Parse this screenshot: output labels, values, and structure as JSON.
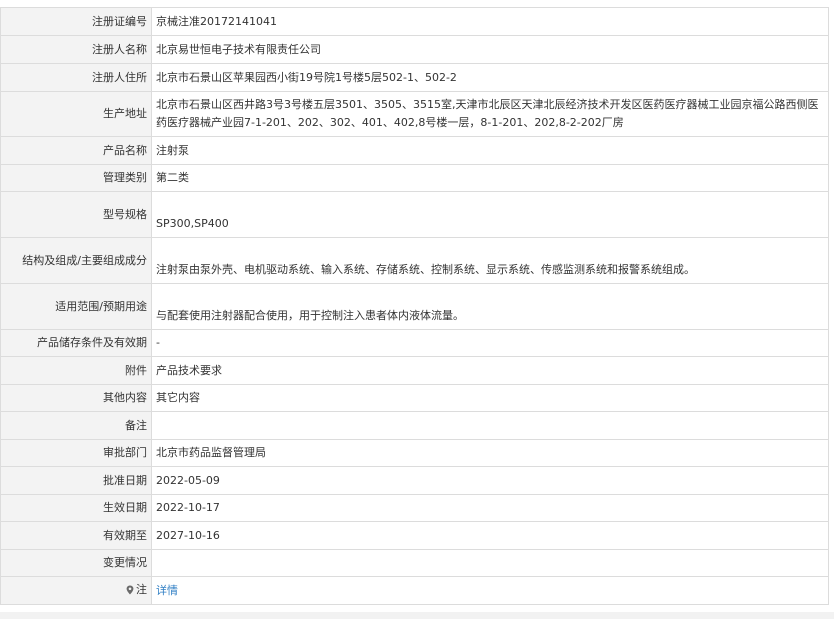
{
  "rows": [
    {
      "label": "注册证编号",
      "value": "京械注准20172141041"
    },
    {
      "label": "注册人名称",
      "value": "北京易世恒电子技术有限责任公司"
    },
    {
      "label": "注册人住所",
      "value": "北京市石景山区苹果园西小街19号院1号楼5层502-1、502-2"
    },
    {
      "label": "生产地址",
      "value": "北京市石景山区西井路3号3号楼五层3501、3505、3515室,天津市北辰区天津北辰经济技术开发区医药医疗器械工业园京福公路西侧医药医疗器械产业园7-1-201、202、302、401、402,8号楼一层，8-1-201、202,8-2-202厂房"
    },
    {
      "label": "产品名称",
      "value": "注射泵"
    },
    {
      "label": "管理类别",
      "value": "第二类"
    },
    {
      "label": "型号规格",
      "value": "SP300,SP400"
    },
    {
      "label": "结构及组成/主要组成成分",
      "value": "注射泵由泵外壳、电机驱动系统、输入系统、存储系统、控制系统、显示系统、传感监测系统和报警系统组成。"
    },
    {
      "label": "适用范围/预期用途",
      "value": "与配套使用注射器配合使用，用于控制注入患者体内液体流量。"
    },
    {
      "label": "产品储存条件及有效期",
      "value": "-"
    },
    {
      "label": "附件",
      "value": "产品技术要求"
    },
    {
      "label": "其他内容",
      "value": "其它内容"
    },
    {
      "label": "备注",
      "value": ""
    },
    {
      "label": "审批部门",
      "value": "北京市药品监督管理局"
    },
    {
      "label": "批准日期",
      "value": "2022-05-09"
    },
    {
      "label": "生效日期",
      "value": "2022-10-17"
    },
    {
      "label": "有效期至",
      "value": "2027-10-16"
    },
    {
      "label": "变更情况",
      "value": ""
    },
    {
      "label": "注",
      "value": "详情"
    }
  ],
  "note_icon": "location-pin-icon"
}
